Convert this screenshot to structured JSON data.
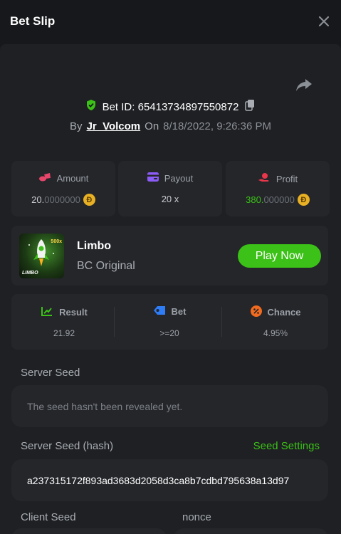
{
  "header": {
    "title": "Bet Slip",
    "close_icon": "close-icon"
  },
  "bet": {
    "id_label": "Bet ID: 6541373489755087​2",
    "id_text": "Bet ID: 65413734897550872",
    "by_label": "By",
    "user": "Jr_Volcom",
    "on_label": "On",
    "date": "8/18/2022, 9:26:36 PM"
  },
  "stats": {
    "amount": {
      "label": "Amount",
      "value_main": "20.",
      "value_dim": "0000000",
      "icon": "coins-icon",
      "icon_color": "#e8456a"
    },
    "payout": {
      "label": "Payout",
      "value": "20 x",
      "icon": "card-icon",
      "icon_color": "#8b5cf6"
    },
    "profit": {
      "label": "Profit",
      "value_main": "380.",
      "value_dim": "000000",
      "icon": "hand-coin-icon",
      "icon_color": "#e8364b"
    },
    "coin_symbol": "Đ"
  },
  "game": {
    "name": "Limbo",
    "subtitle": "BC Original",
    "thumb_label": "LIMBO",
    "thumb_badge": "500x",
    "play_label": "Play Now"
  },
  "result": {
    "result_label": "Result",
    "result_value": "21.92",
    "bet_label": "Bet",
    "bet_value": ">=20",
    "chance_label": "Chance",
    "chance_value": "4.95%"
  },
  "seeds": {
    "server_label": "Server Seed",
    "server_value": "The seed hasn't been revealed yet.",
    "hash_label": "Server Seed (hash)",
    "settings_label": "Seed Settings",
    "hash_value": "a237315172f893ad3683d2058d3ca8b7cdbd795638a13d97",
    "client_label": "Client Seed",
    "nonce_label": "nonce"
  },
  "colors": {
    "accent_green": "#3bc117",
    "background": "#17181b",
    "panel": "#1e2023",
    "card": "#24262a"
  }
}
